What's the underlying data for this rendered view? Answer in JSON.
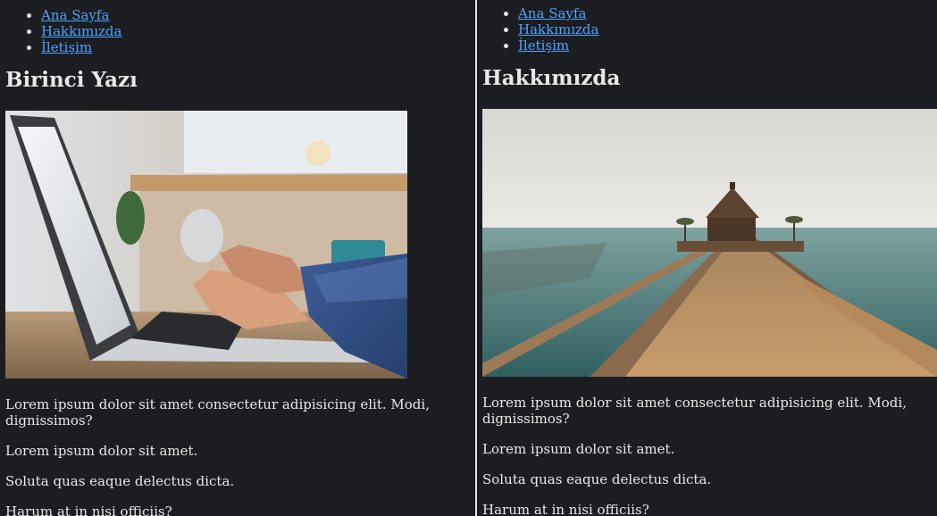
{
  "left": {
    "nav": [
      "Ana Sayfa",
      "Hakkımızda",
      "İletişim"
    ],
    "heading": "Birinci Yazı",
    "image": "laptop-typing-photo",
    "paragraphs": [
      "Lorem ipsum dolor sit amet consectetur adipisicing elit. Modi, dignissimos?",
      "Lorem ipsum dolor sit amet.",
      "Soluta quas eaque delectus dicta.",
      "Harum at in nisi officiis?"
    ]
  },
  "right": {
    "nav": [
      "Ana Sayfa",
      "Hakkımızda",
      "İletişim"
    ],
    "heading": "Hakkımızda",
    "image": "pier-sea-photo",
    "paragraphs": [
      "Lorem ipsum dolor sit amet consectetur adipisicing elit. Modi, dignissimos?",
      "Lorem ipsum dolor sit amet.",
      "Soluta quas eaque delectus dicta.",
      "Harum at in nisi officiis?"
    ]
  },
  "colors": {
    "background": "#1b1d20",
    "text": "#e8e8e8",
    "link": "#4ea3ff",
    "divider": "#e6e6e6"
  }
}
